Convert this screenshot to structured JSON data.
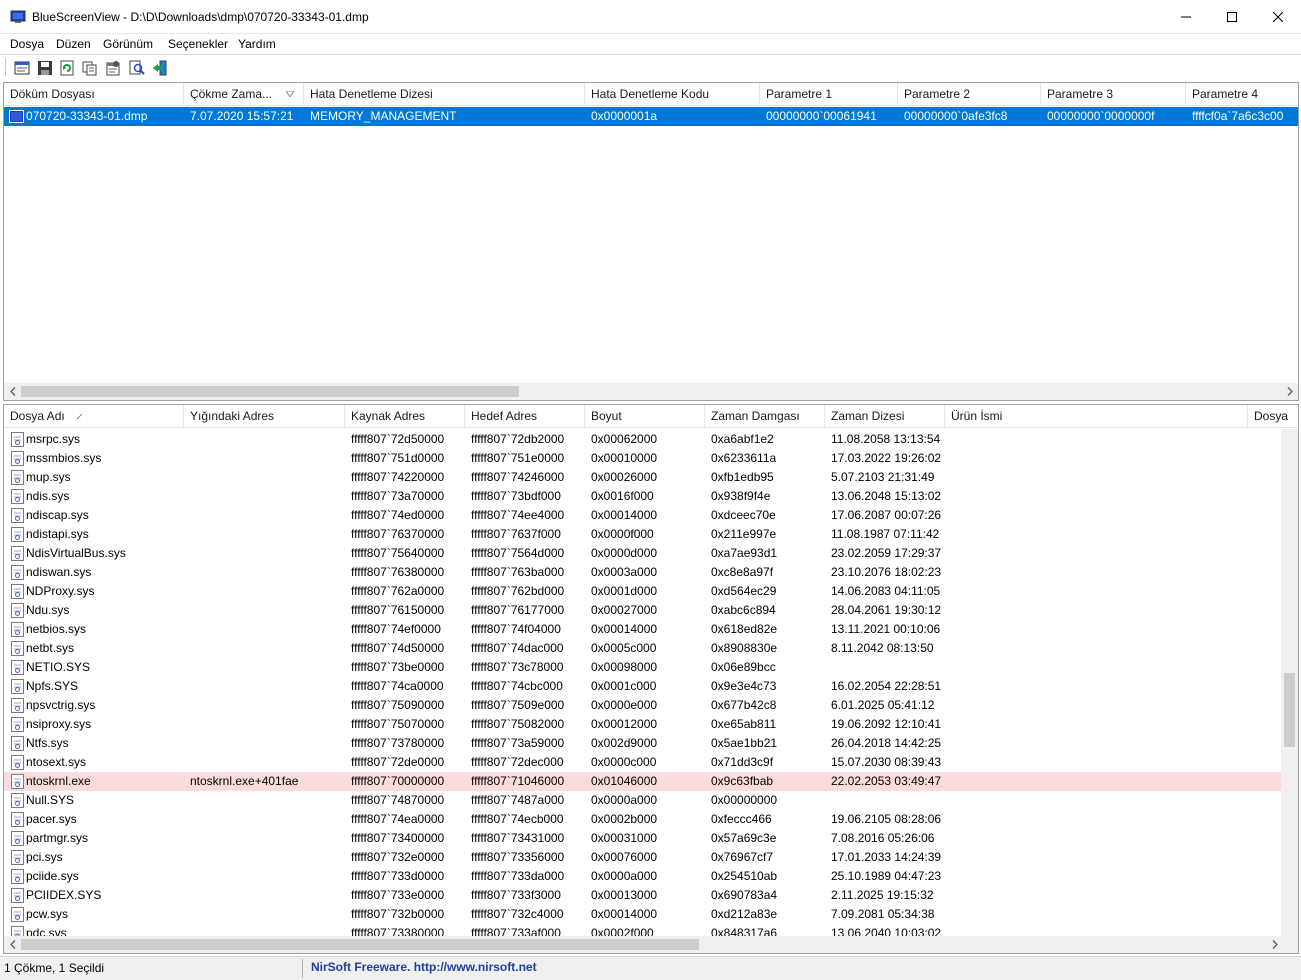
{
  "window": {
    "title": "BlueScreenView  -  D:\\D\\Downloads\\dmp\\070720-33343-01.dmp"
  },
  "menu": [
    "Dosya",
    "Düzen",
    "Görünüm",
    "Seçenekler",
    "Yardım"
  ],
  "toolbar": {
    "icons": [
      "properties-icon",
      "save-icon",
      "refresh-icon",
      "copy-icon",
      "advanced-options-icon",
      "find-icon",
      "exit-icon"
    ]
  },
  "upper_table": {
    "columns": [
      "Döküm Dosyası",
      "Çökme Zama...",
      "Hata Denetleme Dizesi",
      "Hata Denetleme Kodu",
      "Parametre 1",
      "Parametre 2",
      "Parametre 3",
      "Parametre 4"
    ],
    "sorted_column": "Çökme Zama...",
    "rows": [
      {
        "dump_file": "070720-33343-01.dmp",
        "crash_time": "7.07.2020 15:57:21",
        "bug_check_string": "MEMORY_MANAGEMENT",
        "bug_check_code": "0x0000001a",
        "param1": "00000000`00061941",
        "param2": "00000000`0afe3fc8",
        "param3": "00000000`0000000f",
        "param4": "ffffcf0a`7a6c3c00",
        "selected": true
      }
    ]
  },
  "lower_table": {
    "columns": [
      "Dosya Adı",
      "Yığındaki Adres",
      "Kaynak Adres",
      "Hedef Adres",
      "Boyut",
      "Zaman Damgası",
      "Zaman Dizesi",
      "Ürün İsmi",
      "Dosya"
    ],
    "sorted_column": "Dosya Adı",
    "rows": [
      {
        "name": "msrpc.sys",
        "stack": "",
        "from": "fffff807`72d50000",
        "to": "fffff807`72db2000",
        "size": "0x00062000",
        "stamp": "0xa6abf1e2",
        "time": "11.08.2058 13:13:54"
      },
      {
        "name": "mssmbios.sys",
        "stack": "",
        "from": "fffff807`751d0000",
        "to": "fffff807`751e0000",
        "size": "0x00010000",
        "stamp": "0x6233611a",
        "time": "17.03.2022 19:26:02"
      },
      {
        "name": "mup.sys",
        "stack": "",
        "from": "fffff807`74220000",
        "to": "fffff807`74246000",
        "size": "0x00026000",
        "stamp": "0xfb1edb95",
        "time": "5.07.2103 21:31:49"
      },
      {
        "name": "ndis.sys",
        "stack": "",
        "from": "fffff807`73a70000",
        "to": "fffff807`73bdf000",
        "size": "0x0016f000",
        "stamp": "0x938f9f4e",
        "time": "13.06.2048 15:13:02"
      },
      {
        "name": "ndiscap.sys",
        "stack": "",
        "from": "fffff807`74ed0000",
        "to": "fffff807`74ee4000",
        "size": "0x00014000",
        "stamp": "0xdceec70e",
        "time": "17.06.2087 00:07:26"
      },
      {
        "name": "ndistapi.sys",
        "stack": "",
        "from": "fffff807`76370000",
        "to": "fffff807`7637f000",
        "size": "0x0000f000",
        "stamp": "0x211e997e",
        "time": "11.08.1987 07:11:42"
      },
      {
        "name": "NdisVirtualBus.sys",
        "stack": "",
        "from": "fffff807`75640000",
        "to": "fffff807`7564d000",
        "size": "0x0000d000",
        "stamp": "0xa7ae93d1",
        "time": "23.02.2059 17:29:37"
      },
      {
        "name": "ndiswan.sys",
        "stack": "",
        "from": "fffff807`76380000",
        "to": "fffff807`763ba000",
        "size": "0x0003a000",
        "stamp": "0xc8e8a97f",
        "time": "23.10.2076 18:02:23"
      },
      {
        "name": "NDProxy.sys",
        "stack": "",
        "from": "fffff807`762a0000",
        "to": "fffff807`762bd000",
        "size": "0x0001d000",
        "stamp": "0xd564ec29",
        "time": "14.06.2083 04:11:05"
      },
      {
        "name": "Ndu.sys",
        "stack": "",
        "from": "fffff807`76150000",
        "to": "fffff807`76177000",
        "size": "0x00027000",
        "stamp": "0xabc6c894",
        "time": "28.04.2061 19:30:12"
      },
      {
        "name": "netbios.sys",
        "stack": "",
        "from": "fffff807`74ef0000",
        "to": "fffff807`74f04000",
        "size": "0x00014000",
        "stamp": "0x618ed82e",
        "time": "13.11.2021 00:10:06"
      },
      {
        "name": "netbt.sys",
        "stack": "",
        "from": "fffff807`74d50000",
        "to": "fffff807`74dac000",
        "size": "0x0005c000",
        "stamp": "0x8908830e",
        "time": "8.11.2042 08:13:50"
      },
      {
        "name": "NETIO.SYS",
        "stack": "",
        "from": "fffff807`73be0000",
        "to": "fffff807`73c78000",
        "size": "0x00098000",
        "stamp": "0x06e89bcc",
        "time": ""
      },
      {
        "name": "Npfs.SYS",
        "stack": "",
        "from": "fffff807`74ca0000",
        "to": "fffff807`74cbc000",
        "size": "0x0001c000",
        "stamp": "0x9e3e4c73",
        "time": "16.02.2054 22:28:51"
      },
      {
        "name": "npsvctrig.sys",
        "stack": "",
        "from": "fffff807`75090000",
        "to": "fffff807`7509e000",
        "size": "0x0000e000",
        "stamp": "0x677b42c8",
        "time": "6.01.2025 05:41:12"
      },
      {
        "name": "nsiproxy.sys",
        "stack": "",
        "from": "fffff807`75070000",
        "to": "fffff807`75082000",
        "size": "0x00012000",
        "stamp": "0xe65ab811",
        "time": "19.06.2092 12:10:41"
      },
      {
        "name": "Ntfs.sys",
        "stack": "",
        "from": "fffff807`73780000",
        "to": "fffff807`73a59000",
        "size": "0x002d9000",
        "stamp": "0x5ae1bb21",
        "time": "26.04.2018 14:42:25"
      },
      {
        "name": "ntosext.sys",
        "stack": "",
        "from": "fffff807`72de0000",
        "to": "fffff807`72dec000",
        "size": "0x0000c000",
        "stamp": "0x71dd3c9f",
        "time": "15.07.2030 08:39:43"
      },
      {
        "name": "ntoskrnl.exe",
        "stack": "ntoskrnl.exe+401fae",
        "from": "fffff807`70000000",
        "to": "fffff807`71046000",
        "size": "0x01046000",
        "stamp": "0x9c63fbab",
        "time": "22.02.2053 03:49:47",
        "highlight": true
      },
      {
        "name": "Null.SYS",
        "stack": "",
        "from": "fffff807`74870000",
        "to": "fffff807`7487a000",
        "size": "0x0000a000",
        "stamp": "0x00000000",
        "time": ""
      },
      {
        "name": "pacer.sys",
        "stack": "",
        "from": "fffff807`74ea0000",
        "to": "fffff807`74ecb000",
        "size": "0x0002b000",
        "stamp": "0xfeccc466",
        "time": "19.06.2105 08:28:06"
      },
      {
        "name": "partmgr.sys",
        "stack": "",
        "from": "fffff807`73400000",
        "to": "fffff807`73431000",
        "size": "0x00031000",
        "stamp": "0x57a69c3e",
        "time": "7.08.2016 05:26:06"
      },
      {
        "name": "pci.sys",
        "stack": "",
        "from": "fffff807`732e0000",
        "to": "fffff807`73356000",
        "size": "0x00076000",
        "stamp": "0x76967cf7",
        "time": "17.01.2033 14:24:39"
      },
      {
        "name": "pciide.sys",
        "stack": "",
        "from": "fffff807`733d0000",
        "to": "fffff807`733da000",
        "size": "0x0000a000",
        "stamp": "0x254510ab",
        "time": "25.10.1989 04:47:23"
      },
      {
        "name": "PCIIDEX.SYS",
        "stack": "",
        "from": "fffff807`733e0000",
        "to": "fffff807`733f3000",
        "size": "0x00013000",
        "stamp": "0x690783a4",
        "time": "2.11.2025 19:15:32"
      },
      {
        "name": "pcw.sys",
        "stack": "",
        "from": "fffff807`732b0000",
        "to": "fffff807`732c4000",
        "size": "0x00014000",
        "stamp": "0xd212a83e",
        "time": "7.09.2081 05:34:38"
      },
      {
        "name": "pdc.sys",
        "stack": "",
        "from": "fffff807`73380000",
        "to": "fffff807`733af000",
        "size": "0x0002f000",
        "stamp": "0x848317a6",
        "time": "13.06.2040 10:03:02"
      }
    ]
  },
  "status": {
    "count": "1 Çökme, 1 Seçildi",
    "credit": "NirSoft Freeware.  http://www.nirsoft.net"
  },
  "colors": {
    "selection": "#0078d7",
    "highlight_row": "#fbdcdc",
    "credit_text": "#1e3fa0"
  }
}
